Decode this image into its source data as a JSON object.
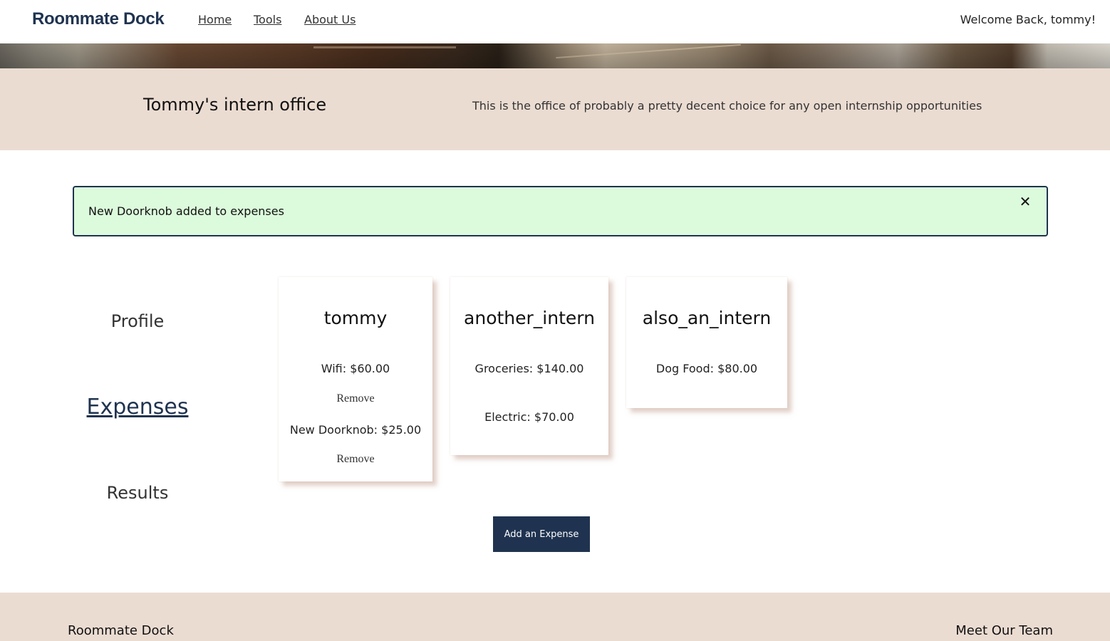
{
  "nav": {
    "brand": "Roommate Dock",
    "links": [
      {
        "label": "Home"
      },
      {
        "label": "Tools"
      },
      {
        "label": "About Us"
      }
    ],
    "welcome": "Welcome Back, tommy!"
  },
  "office": {
    "title": "Tommy's intern office",
    "description": "This is the office of probably a pretty decent choice for any open internship opportunities"
  },
  "alert": {
    "message": "New Doorknob added to expenses",
    "close_label": "✕"
  },
  "sidebar": {
    "items": [
      {
        "label": "Profile"
      },
      {
        "label": "Expenses"
      },
      {
        "label": "Results"
      }
    ]
  },
  "cards": [
    {
      "name": "tommy",
      "expenses": [
        {
          "text": "Wifi: $60.00",
          "remove": "Remove"
        },
        {
          "text": "New Doorknob: $25.00",
          "remove": "Remove"
        }
      ]
    },
    {
      "name": "another_intern",
      "expenses": [
        {
          "text": "Groceries: $140.00"
        },
        {
          "text": "Electric: $70.00"
        }
      ]
    },
    {
      "name": "also_an_intern",
      "expenses": [
        {
          "text": "Dog Food: $80.00"
        }
      ]
    }
  ],
  "actions": {
    "add_expense": "Add an Expense"
  },
  "footer": {
    "brand": "Roommate Dock",
    "team": "Meet Our Team"
  },
  "colors": {
    "brand_navy": "#1f3350",
    "band_beige": "#ebdcd2",
    "alert_green": "#dcfadc"
  }
}
